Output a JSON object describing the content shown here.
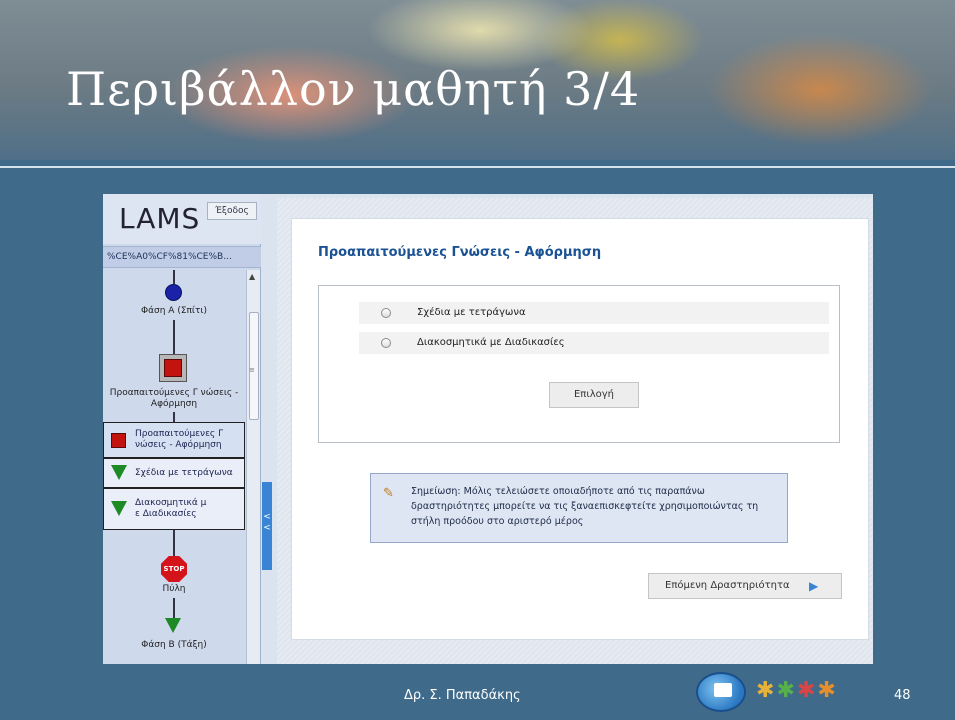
{
  "slide": {
    "title": "Περιβάλλον μαθητή 3/4",
    "author": "Δρ. Σ. Παπαδάκης",
    "page_number": "48"
  },
  "sidebar": {
    "logo": "LAMS",
    "exit_label": "Έξοδος",
    "sequence_title": "%CE%A0%CF%81%CE%B...",
    "nodes": {
      "phase_a": "Φάση Α (Σπίτι)",
      "prereq_node": "Προαπαιτούμενες Γ νώσεις - Αφόρμηση",
      "gate": "Πύλη",
      "gate_sign": "STOP",
      "phase_b": "Φάση Β (Τάξη)"
    },
    "activities": [
      {
        "label": "Προαπαιτούμενες Γ νώσεις - Αφόρμηση",
        "icon": "red-square-icon"
      },
      {
        "label": "Σχέδια με τετράγωνα",
        "icon": "green-triangle-icon"
      },
      {
        "label": "Διακοσμητικά μ ε Διαδικασίες",
        "icon": "green-triangle-icon"
      }
    ],
    "collapse_label": "<  <"
  },
  "main": {
    "heading": "Προαπαιτούμενες Γνώσεις - Αφόρμηση",
    "options": [
      {
        "label": "Σχέδια με τετράγωνα",
        "selected": false
      },
      {
        "label": "Διακοσμητικά με Διαδικασίες",
        "selected": false
      }
    ],
    "choose_button": "Επιλογή",
    "note": "Σημείωση: Μόλις τελειώσετε οποιαδήποτε από τις παραπάνω δραστηριότητες μπορείτε να τις ξαναεπισκεφτείτε χρησιμοποιώντας τη στήλη προόδου στο αριστερό μέρος",
    "next_button": "Επόμενη Δραστηριότητα"
  },
  "colors": {
    "background": "#3f6a8a",
    "heading_blue": "#1a5294",
    "active_red": "#c3130f",
    "complete_green": "#1e8a26",
    "current_blue": "#1a23a8"
  }
}
